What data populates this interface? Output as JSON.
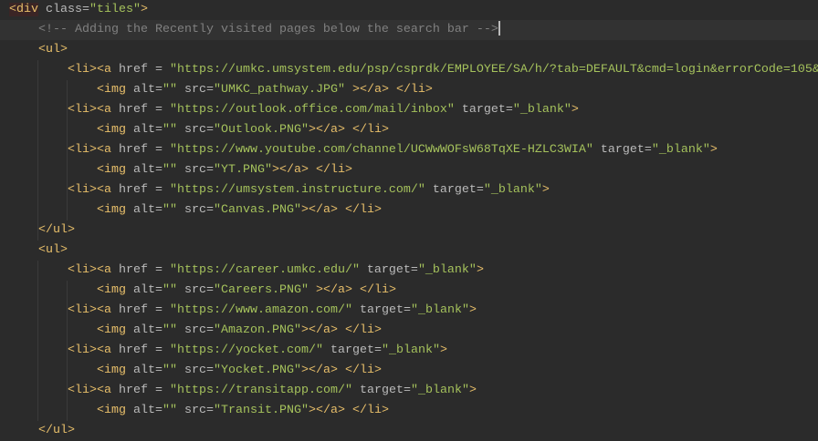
{
  "colors": {
    "background": "#2b2b2b",
    "tag": "#e8bf6a",
    "attribute": "#bababa",
    "string": "#a5c25c",
    "comment": "#808080"
  },
  "lines": [
    {
      "indent": 0,
      "tokens": [
        [
          "t",
          "<div"
        ],
        [
          "a",
          " class="
        ],
        [
          "s",
          "\"tiles\""
        ],
        [
          "t",
          ">"
        ]
      ],
      "match": true
    },
    {
      "indent": 1,
      "tokens": [
        [
          "c",
          "<!-- Adding the Recently visited pages below the search bar -->"
        ]
      ],
      "current": true,
      "caret": true
    },
    {
      "indent": 1,
      "tokens": [
        [
          "t",
          "<ul>"
        ]
      ]
    },
    {
      "indent": 2,
      "tokens": [
        [
          "t",
          "<li><a"
        ],
        [
          "a",
          " href = "
        ],
        [
          "s",
          "\"https://umkc.umsystem.edu/psp/csprdk/EMPLOYEE/SA/h/?tab=DEFAULT&cmd=login&errorCode=105&"
        ]
      ]
    },
    {
      "indent": 3,
      "tokens": [
        [
          "t",
          "<img"
        ],
        [
          "a",
          " alt="
        ],
        [
          "s",
          "\"\""
        ],
        [
          "a",
          " src="
        ],
        [
          "s",
          "\"UMKC_pathway.JPG\""
        ],
        [
          "t",
          " ></a> </li>"
        ]
      ]
    },
    {
      "indent": 2,
      "tokens": [
        [
          "t",
          "<li><a"
        ],
        [
          "a",
          " href = "
        ],
        [
          "s",
          "\"https://outlook.office.com/mail/inbox\""
        ],
        [
          "a",
          " target="
        ],
        [
          "s",
          "\"_blank\""
        ],
        [
          "t",
          ">"
        ]
      ]
    },
    {
      "indent": 3,
      "tokens": [
        [
          "t",
          "<img"
        ],
        [
          "a",
          " alt="
        ],
        [
          "s",
          "\"\""
        ],
        [
          "a",
          " src="
        ],
        [
          "s",
          "\"Outlook.PNG\""
        ],
        [
          "t",
          "></a> </li>"
        ]
      ]
    },
    {
      "indent": 2,
      "tokens": [
        [
          "t",
          "<li><a"
        ],
        [
          "a",
          " href = "
        ],
        [
          "s",
          "\"https://www.youtube.com/channel/UCWwWOFsW68TqXE-HZLC3WIA\""
        ],
        [
          "a",
          " target="
        ],
        [
          "s",
          "\"_blank\""
        ],
        [
          "t",
          ">"
        ]
      ]
    },
    {
      "indent": 3,
      "tokens": [
        [
          "t",
          "<img"
        ],
        [
          "a",
          " alt="
        ],
        [
          "s",
          "\"\""
        ],
        [
          "a",
          " src="
        ],
        [
          "s",
          "\"YT.PNG\""
        ],
        [
          "t",
          "></a> </li>"
        ]
      ]
    },
    {
      "indent": 2,
      "tokens": [
        [
          "t",
          "<li><a"
        ],
        [
          "a",
          " href = "
        ],
        [
          "s",
          "\"https://umsystem.instructure.com/\""
        ],
        [
          "a",
          " target="
        ],
        [
          "s",
          "\"_blank\""
        ],
        [
          "t",
          ">"
        ]
      ]
    },
    {
      "indent": 3,
      "tokens": [
        [
          "t",
          "<img"
        ],
        [
          "a",
          " alt="
        ],
        [
          "s",
          "\"\""
        ],
        [
          "a",
          " src="
        ],
        [
          "s",
          "\"Canvas.PNG\""
        ],
        [
          "t",
          "></a> </li>"
        ]
      ]
    },
    {
      "indent": 1,
      "tokens": [
        [
          "t",
          "</ul>"
        ]
      ]
    },
    {
      "indent": 1,
      "tokens": [
        [
          "t",
          "<ul>"
        ]
      ]
    },
    {
      "indent": 2,
      "tokens": [
        [
          "t",
          "<li><a"
        ],
        [
          "a",
          " href = "
        ],
        [
          "s",
          "\"https://career.umkc.edu/\""
        ],
        [
          "a",
          " target="
        ],
        [
          "s",
          "\"_blank\""
        ],
        [
          "t",
          ">"
        ]
      ]
    },
    {
      "indent": 3,
      "tokens": [
        [
          "t",
          "<img"
        ],
        [
          "a",
          " alt="
        ],
        [
          "s",
          "\"\""
        ],
        [
          "a",
          " src="
        ],
        [
          "s",
          "\"Careers.PNG\""
        ],
        [
          "t",
          " ></a> </li>"
        ]
      ]
    },
    {
      "indent": 2,
      "tokens": [
        [
          "t",
          "<li><a"
        ],
        [
          "a",
          " href = "
        ],
        [
          "s",
          "\"https://www.amazon.com/\""
        ],
        [
          "a",
          " target="
        ],
        [
          "s",
          "\"_blank\""
        ],
        [
          "t",
          ">"
        ]
      ]
    },
    {
      "indent": 3,
      "tokens": [
        [
          "t",
          "<img"
        ],
        [
          "a",
          " alt="
        ],
        [
          "s",
          "\"\""
        ],
        [
          "a",
          " src="
        ],
        [
          "s",
          "\"Amazon.PNG\""
        ],
        [
          "t",
          "></a> </li>"
        ]
      ]
    },
    {
      "indent": 2,
      "tokens": [
        [
          "t",
          "<li><a"
        ],
        [
          "a",
          " href = "
        ],
        [
          "s",
          "\"https://yocket.com/\""
        ],
        [
          "a",
          " target="
        ],
        [
          "s",
          "\"_blank\""
        ],
        [
          "t",
          ">"
        ]
      ]
    },
    {
      "indent": 3,
      "tokens": [
        [
          "t",
          "<img"
        ],
        [
          "a",
          " alt="
        ],
        [
          "s",
          "\"\""
        ],
        [
          "a",
          " src="
        ],
        [
          "s",
          "\"Yocket.PNG\""
        ],
        [
          "t",
          "></a> </li>"
        ]
      ]
    },
    {
      "indent": 2,
      "tokens": [
        [
          "t",
          "<li><a"
        ],
        [
          "a",
          " href = "
        ],
        [
          "s",
          "\"https://transitapp.com/\""
        ],
        [
          "a",
          " target="
        ],
        [
          "s",
          "\"_blank\""
        ],
        [
          "t",
          ">"
        ]
      ]
    },
    {
      "indent": 3,
      "tokens": [
        [
          "t",
          "<img"
        ],
        [
          "a",
          " alt="
        ],
        [
          "s",
          "\"\""
        ],
        [
          "a",
          " src="
        ],
        [
          "s",
          "\"Transit.PNG\""
        ],
        [
          "t",
          "></a> </li>"
        ]
      ]
    },
    {
      "indent": 1,
      "tokens": [
        [
          "t",
          "</ul>"
        ]
      ]
    }
  ]
}
